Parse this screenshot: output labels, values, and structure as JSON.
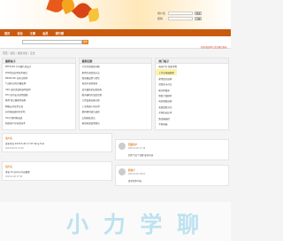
{
  "header": {
    "login": {
      "user_label": "用户名",
      "pass_label": "密码",
      "login_button": "登录",
      "register_button": "注册"
    }
  },
  "nav": {
    "items": [
      "首页",
      "论坛",
      "文章",
      "会员",
      "排行榜"
    ]
  },
  "toolbar": {
    "search_placeholder": "",
    "search_button": "搜索",
    "tagline": "欢迎光临本站 请注册后发帖 ·"
  },
  "breadcrumb": {
    "text": "首页 › 论坛 › 综合讨论 › 正文"
  },
  "columns": [
    {
      "title": "最新帖子",
      "items": [
        "PPT2016 汽车图片的设计",
        "LED灯珠应用技术规范",
        "8000mAh 充电宝推荐",
        "气动阀 如何正确使用",
        "UKV 高压清洗机使用说明",
        "KTV 如何安全使用线路",
        "家用 吸尘器推荐选购",
        "网络安全技术交流",
        "如何挑选更好的手机",
        "3D 打印材料选择",
        "新能源汽车电池技术"
      ]
    },
    {
      "title": "最新回复",
      "items": [
        "汽车灯具维修问题",
        "家用空调清洗方法",
        "路由器设置与优化",
        "电动车电池保养",
        "显示器色彩校准指南",
        "服务器机房温度控制",
        "大型设备运输注意",
        "工业机器人的应用",
        "数码相机镜头选择",
        "太阳能板清洁",
        "移动电源使用规范"
      ]
    },
    {
      "title": "热门帖子",
      "items": [
        "电动汽车 续航里程",
        "工作站电脑配置",
        "家用监控选购",
        "游戏显卡对比",
        "笔记本散热",
        "智能门锁推荐",
        "电竞键盘选择",
        "无线耳机对比",
        "手机快充技术",
        "路由器选择",
        "平板电脑"
      ]
    }
  ],
  "posts": [
    {
      "name": "用户名",
      "meta": "2023-06-05 12:00",
      "text": "发布时间 2023-6-26 17:25 Tang Hua"
    },
    {
      "name": "回复用户",
      "meta": "2023-6-26 17:38",
      "text": "回复了这个话题 更多内容"
    },
    {
      "name": "用户名",
      "meta": "2023-6-26 17:50",
      "text": "发帖 tongxing 内容摘要"
    },
    {
      "name": "新用户",
      "meta": "2023-6-26 18:01",
      "text": "更多回复内容"
    }
  ],
  "brand": {
    "text": "小 力 学 聊"
  },
  "colors": {
    "nav": "#c95a0f",
    "accent": "#e27b1c",
    "highlight": "#fff3a8"
  }
}
